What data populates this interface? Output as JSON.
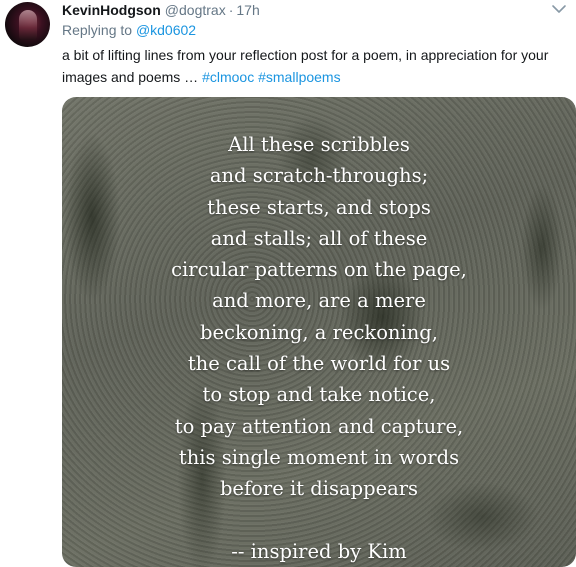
{
  "author": {
    "name": "KevinHodgson",
    "handle": "@dogtrax",
    "separator": "·",
    "time": "17h"
  },
  "reply": {
    "prefix": "Replying to",
    "mention": "@kd0602"
  },
  "tweet": {
    "text": "a bit of lifting lines from your reflection post for a poem, in appreciation for your images and poems …",
    "hashtags": [
      "#clmooc",
      "#smallpoems"
    ]
  },
  "media": {
    "poem_lines": [
      "All these scribbles",
      "and scratch-throughs;",
      "these starts, and stops",
      "and stalls; all of these",
      "circular patterns on the page,",
      "and more, are a mere",
      "beckoning, a reckoning,",
      "the call of the world for us",
      "to stop and take notice,",
      "to pay attention and capture,",
      "this single moment in words",
      "before it disappears"
    ],
    "attribution": "-- inspired by Kim"
  },
  "icons": {
    "caret": "chevron-down-icon"
  },
  "colors": {
    "link": "#1b95e0",
    "muted": "#657786",
    "text": "#14171a"
  }
}
